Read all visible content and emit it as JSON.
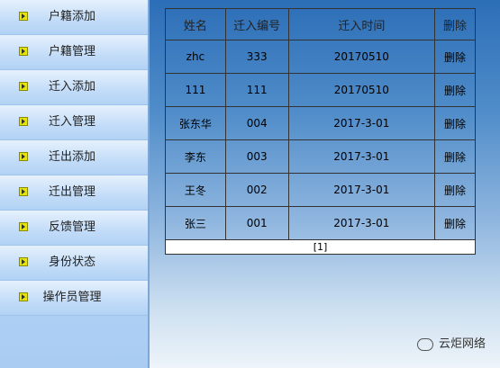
{
  "sidebar": {
    "items": [
      {
        "label": "户籍添加"
      },
      {
        "label": "户籍管理"
      },
      {
        "label": "迁入添加"
      },
      {
        "label": "迁入管理"
      },
      {
        "label": "迁出添加"
      },
      {
        "label": "迁出管理"
      },
      {
        "label": "反馈管理"
      },
      {
        "label": "身份状态"
      },
      {
        "label": "操作员管理"
      }
    ]
  },
  "table": {
    "headers": [
      "姓名",
      "迁入编号",
      "迁入时间",
      "删除"
    ],
    "rows": [
      {
        "name": "zhc",
        "no": "333",
        "time": "20170510",
        "action": "删除"
      },
      {
        "name": "111",
        "no": "111",
        "time": "20170510",
        "action": "删除"
      },
      {
        "name": "张东华",
        "no": "004",
        "time": "2017-3-01",
        "action": "删除"
      },
      {
        "name": "李东",
        "no": "003",
        "time": "2017-3-01",
        "action": "删除"
      },
      {
        "name": "王冬",
        "no": "002",
        "time": "2017-3-01",
        "action": "删除"
      },
      {
        "name": "张三",
        "no": "001",
        "time": "2017-3-01",
        "action": "删除"
      }
    ],
    "pager": "[1]"
  },
  "watermark": {
    "text": "云炬网络",
    "icon": "wechat-icon"
  }
}
